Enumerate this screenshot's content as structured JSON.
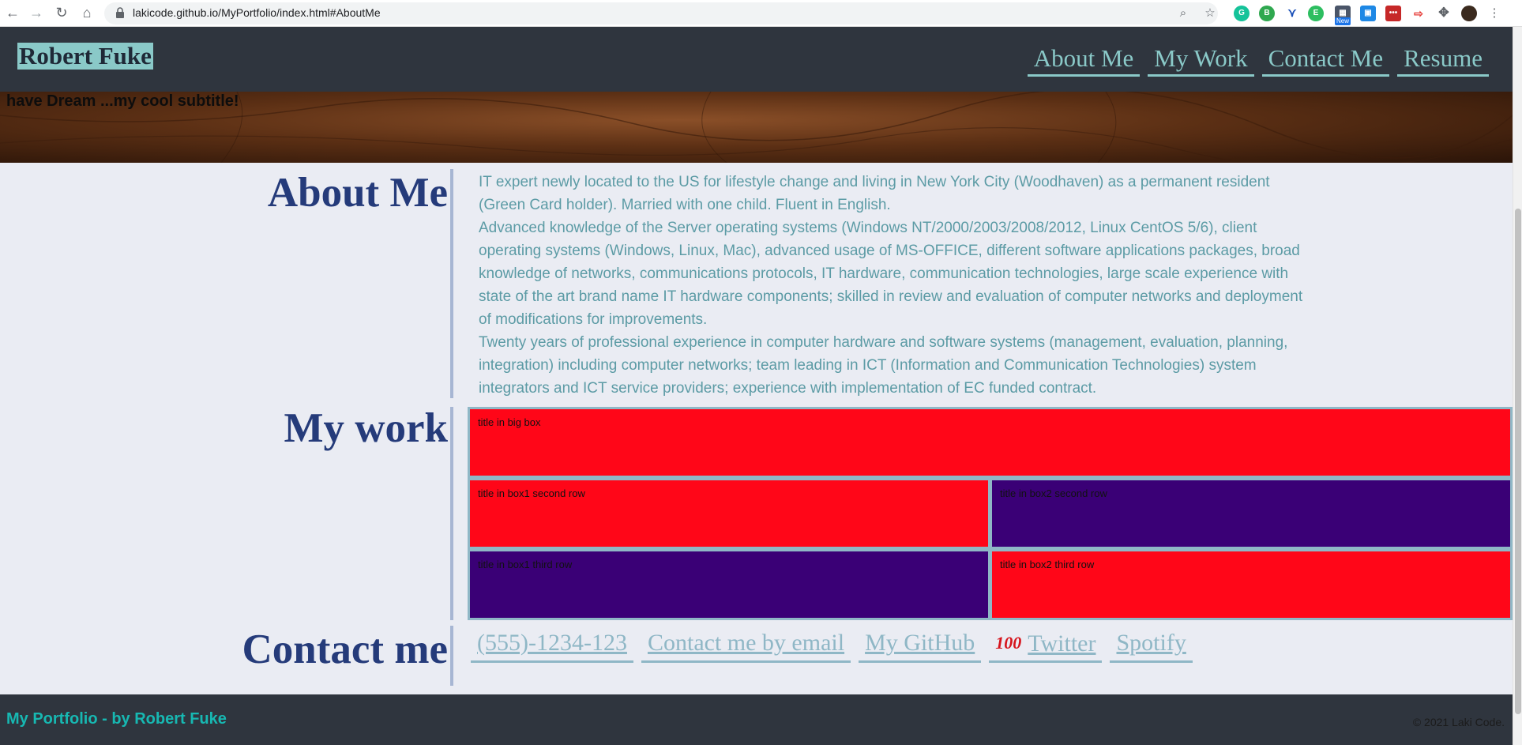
{
  "browser": {
    "url": "lakicode.github.io/MyPortfolio/index.html#AboutMe",
    "back_icon": "arrow-left-icon",
    "forward_icon": "arrow-right-icon",
    "reload_icon": "reload-icon",
    "home_icon": "home-icon",
    "new_badge": "New"
  },
  "header": {
    "brand": "Robert Fuke",
    "nav": [
      "About Me",
      "My Work",
      "Contact Me",
      "Resume"
    ]
  },
  "hero": {
    "subtitle": "have Dream ...my cool subtitle!"
  },
  "about": {
    "title": "About Me",
    "paragraphs": [
      "IT expert newly located to the US for lifestyle change and living in New York City (Woodhaven) as a permanent resident (Green Card holder). Married with one child. Fluent in English.",
      "Advanced knowledge of the Server operating systems (Windows NT/2000/2003/2008/2012, Linux CentOS 5/6), client operating systems (Windows, Linux, Mac), advanced usage of MS-OFFICE, different software applications packages, broad knowledge of networks, communications protocols, IT hardware, communication technologies, large scale experience with state of the art brand name IT hardware components; skilled in review and evaluation of computer networks and deployment of modifications for improvements.",
      "Twenty years of professional experience in computer hardware and software systems (management, evaluation, planning, integration) including computer networks; team leading in ICT (Information and Communication Technologies) system integrators and ICT service providers; experience with implementation of EC funded contract."
    ]
  },
  "work": {
    "title": "My work",
    "boxes": {
      "big": "title in big box",
      "r2b1": "title in box1 second row",
      "r2b2": "title in box2 second row",
      "r3b1": "title in box1 third row",
      "r3b2": "title in box2 third row"
    }
  },
  "contact": {
    "title": "Contact me",
    "links": [
      "(555)-1234-123",
      "Contact me by email",
      "My GitHub",
      "Twitter",
      "Spotify"
    ],
    "twitter_emoji": "100"
  },
  "footer": {
    "left": "My Portfolio - by Robert Fuke",
    "right": "© 2021 Laki Code."
  },
  "colors": {
    "nav_bg": "#2f353e",
    "accent": "#8ac9c8",
    "title": "#253b7a",
    "text": "#5c9ba5",
    "box_red": "#ff0618",
    "box_purple": "#3a0076"
  }
}
